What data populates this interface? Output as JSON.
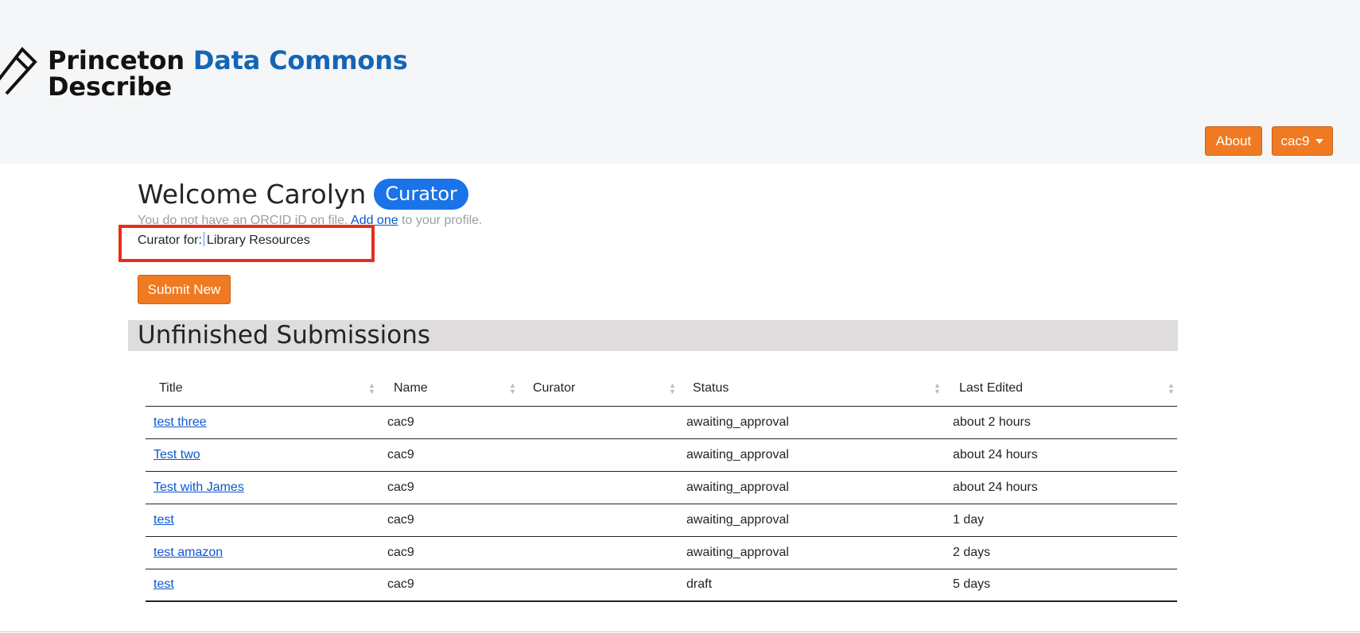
{
  "brand": {
    "name_part1": "Princeton",
    "name_part2": "Data Commons",
    "name_line2": "Describe"
  },
  "nav": {
    "about_label": "About",
    "user_label": "cac9"
  },
  "welcome": {
    "title": "Welcome Carolyn",
    "role_badge": "Curator"
  },
  "orcid_notice": {
    "prefix": "You do not have an ORCID iD on file.",
    "link_text": "Add one",
    "suffix": "to your profile."
  },
  "curator_for": {
    "label": "Curator for:",
    "value": "Library Resources"
  },
  "submit_button": "Submit New",
  "unfinished": {
    "heading": "Unfinished Submissions",
    "columns": [
      "Title",
      "Name",
      "Curator",
      "Status",
      "Last Edited"
    ],
    "rows": [
      {
        "title": "test three",
        "name": "cac9",
        "curator": "",
        "status": "awaiting_approval",
        "last_edited": "about 2 hours"
      },
      {
        "title": "Test two",
        "name": "cac9",
        "curator": "",
        "status": "awaiting_approval",
        "last_edited": "about 24 hours"
      },
      {
        "title": "Test with James",
        "name": "cac9",
        "curator": "",
        "status": "awaiting_approval",
        "last_edited": "about 24 hours"
      },
      {
        "title": "test",
        "name": "cac9",
        "curator": "",
        "status": "awaiting_approval",
        "last_edited": "1 day"
      },
      {
        "title": "test amazon",
        "name": "cac9",
        "curator": "",
        "status": "awaiting_approval",
        "last_edited": "2 days"
      },
      {
        "title": "test",
        "name": "cac9",
        "curator": "",
        "status": "draft",
        "last_edited": "5 days"
      }
    ]
  },
  "colors": {
    "accent_orange": "#f07a22",
    "brand_blue": "#1565b5",
    "badge_blue": "#1a73e8",
    "annotation_red": "#ea2d19"
  },
  "icons": {
    "logo": "pencil-icon",
    "user_menu": "caret-down-icon",
    "sort": "sort-icon"
  }
}
